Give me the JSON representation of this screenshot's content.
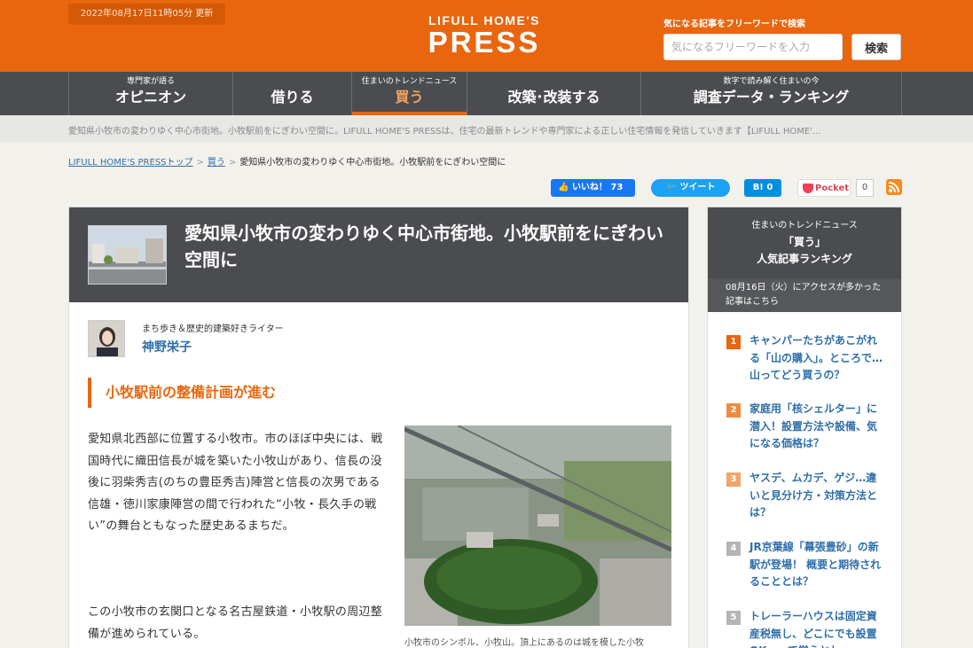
{
  "header": {
    "updated": "2022年08月17日11時05分 更新",
    "logo_line1": "LIFULL HOME'S",
    "logo_line2": "PRESS",
    "search_caption": "気になる記事をフリーワードで検索",
    "search_placeholder": "気になるフリーワードを入力",
    "search_button": "検索"
  },
  "nav": [
    {
      "sub": "専門家が語る",
      "label": "オピニオン",
      "active": false
    },
    {
      "sub": "",
      "label": "借りる",
      "active": false
    },
    {
      "sub": "住まいのトレンドニュース",
      "label": "買う",
      "active": true
    },
    {
      "sub": "",
      "label": "改築･改装する",
      "active": false
    },
    {
      "sub": "数字で読み解く住まいの今",
      "label": "調査データ・ランキング",
      "active": false
    }
  ],
  "tagline": "愛知県小牧市の変わりゆく中心市街地。小牧駅前をにぎわい空間に。LIFULL HOME'S PRESSは、住宅の最新トレンドや専門家による正しい住宅情報を発信していきます【LIFULL HOME'…",
  "breadcrumb": {
    "home": "LIFULL HOME'S PRESSトップ",
    "category": "買う",
    "current": "愛知県小牧市の変わりゆく中心市街地。小牧駅前をにぎわい空間に"
  },
  "share": {
    "facebook": "いいね！ 73",
    "twitter": "ツイート",
    "hatena": "B! 0",
    "pocket": "Pocket",
    "pocket_count": "0"
  },
  "article": {
    "title": "愛知県小牧市の変わりゆく中心市街地。小牧駅前をにぎわい空間に",
    "author_role": "まち歩き＆歴史的建築好きライター",
    "author_name": "神野栄子",
    "section_heading": "小牧駅前の整備計画が進む",
    "paragraph1": "愛知県北西部に位置する小牧市。市のほぼ中央には、戦国時代に織田信長が城を築いた小牧山があり、信長の没後に羽柴秀吉(のちの豊臣秀吉)陣営と信長の次男である信雄・徳川家康陣営の間で行われた“小牧・長久手の戦い”の舞台ともなった歴史あるまちだ。",
    "paragraph2": "この小牧市の玄関口となる名古屋鉄道・小牧駅の周辺整備が進められている。",
    "caption": "小牧市のシンボル、小牧山。頂上にあるのは城を模した小牧"
  },
  "sidebar": {
    "label1": "住まいのトレンドニュース",
    "label2": "「買う」",
    "label3": "人気記事ランキング",
    "date_note": "08月16日（火）にアクセスが多かった記事はこちら",
    "ranking": [
      {
        "rank": "1",
        "title": "キャンパーたちがあこがれる「山の購入」。ところで…山ってどう買うの？",
        "color": "#e9660f"
      },
      {
        "rank": "2",
        "title": "家庭用「核シェルター」に潜入！設置方法や設備、気になる価格は？",
        "color": "#f08a3f"
      },
      {
        "rank": "3",
        "title": "ヤスデ、ムカデ、ゲジ…違いと見分け方・対策方法とは？",
        "color": "#f2a46a"
      },
      {
        "rank": "4",
        "title": "JR京葉線「幕張豊砂」の新駅が登場！ 概要と期待されることとは？",
        "color": "#b5b5b5"
      },
      {
        "rank": "5",
        "title": "トレーラーハウスは固定資産税無し、どこにでも設置OK…って覚えとし...",
        "color": "#b5b5b5"
      }
    ]
  }
}
